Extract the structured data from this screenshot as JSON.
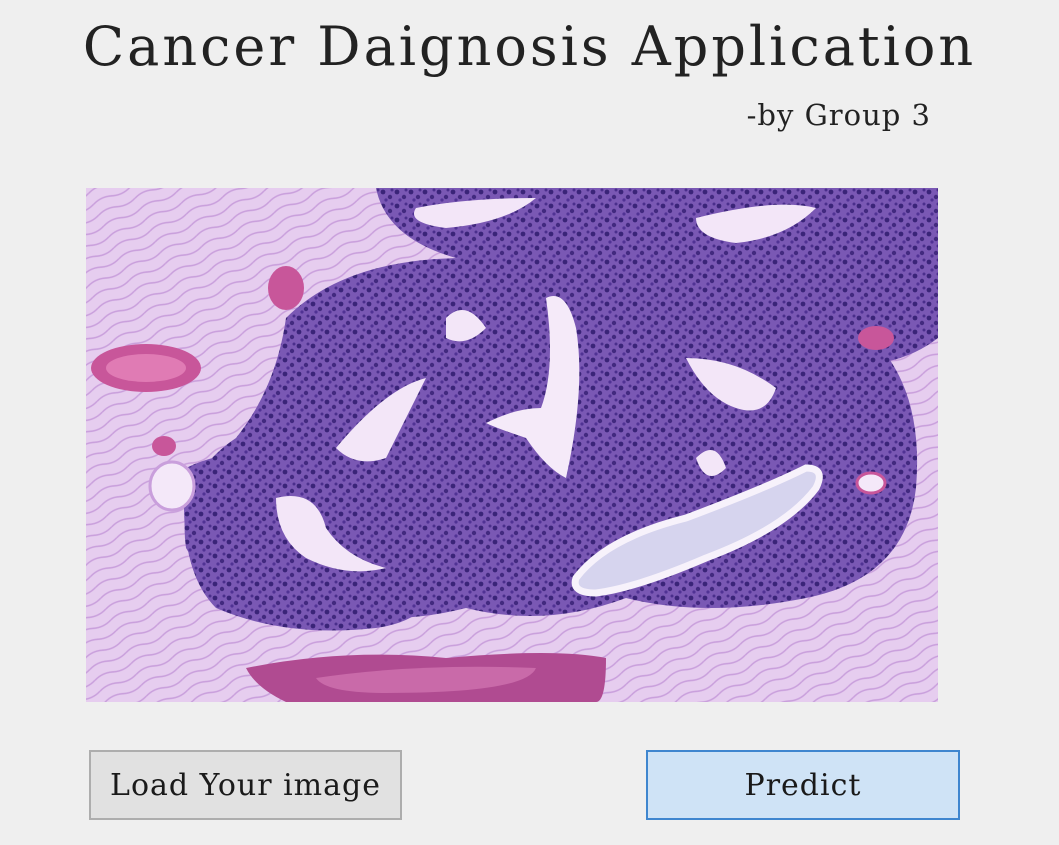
{
  "app": {
    "title": "Cancer Daignosis Application",
    "subtitle": "-by Group 3"
  },
  "preview": {
    "image": "histopathology-tissue-sample",
    "colors": {
      "stroma": "#e7cdf0",
      "epithelium": "#6a4aa8",
      "lumen": "#f4e8f9",
      "blood": "#c8569a"
    }
  },
  "buttons": {
    "load_label": "Load Your image",
    "predict_label": "Predict"
  }
}
